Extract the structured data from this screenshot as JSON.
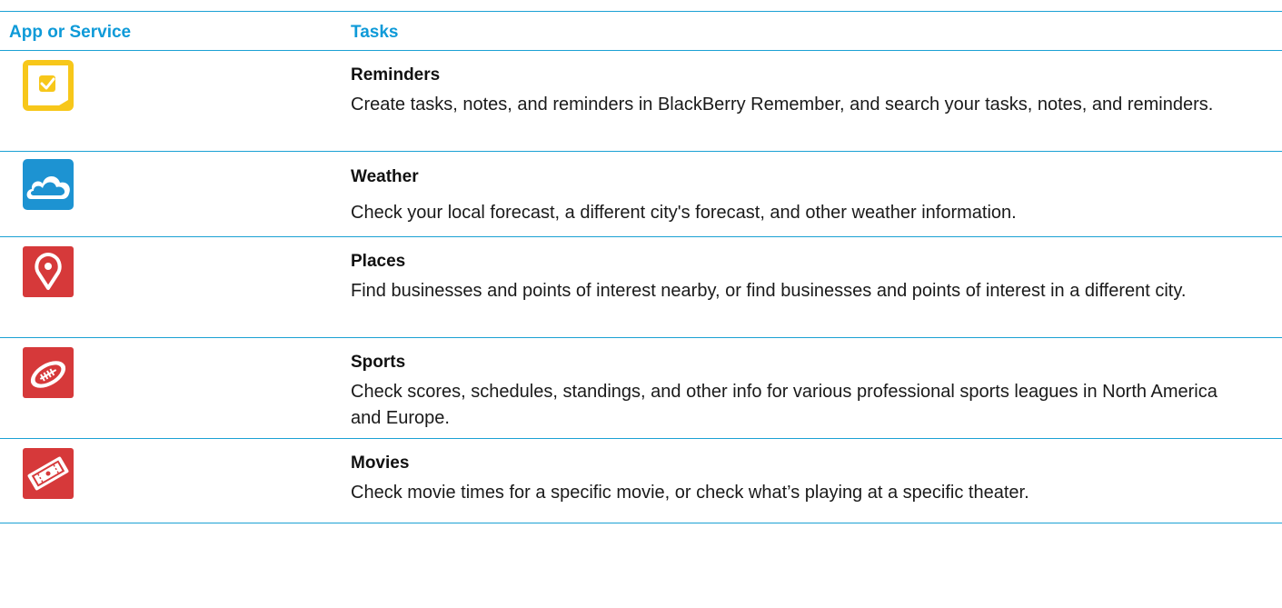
{
  "table": {
    "headers": {
      "app_or_service": "App or Service",
      "tasks": "Tasks"
    },
    "rows": [
      {
        "icon": "reminders-icon",
        "title": "Reminders",
        "description": "Create tasks, notes, and reminders in BlackBerry Remember, and search your tasks, notes, and reminders."
      },
      {
        "icon": "weather-icon",
        "title": "Weather",
        "description": "Check your local forecast, a different city's forecast, and other weather information."
      },
      {
        "icon": "places-icon",
        "title": "Places",
        "description": "Find businesses and points of interest nearby, or find businesses and points of interest in a different city."
      },
      {
        "icon": "sports-icon",
        "title": "Sports",
        "description": "Check scores, schedules, standings, and other info for various professional sports leagues in North America and Europe."
      },
      {
        "icon": "movies-icon",
        "title": "Movies",
        "description": "Check movie times for a specific movie, or check what’s playing at a specific theater."
      }
    ]
  },
  "colors": {
    "accent": "#0e9ad8",
    "rule": "#1ba1d4",
    "reminders": "#f7c71a",
    "weather": "#1d93d2",
    "places": "#d6393a",
    "sports": "#d6393a",
    "movies": "#d6393a"
  }
}
